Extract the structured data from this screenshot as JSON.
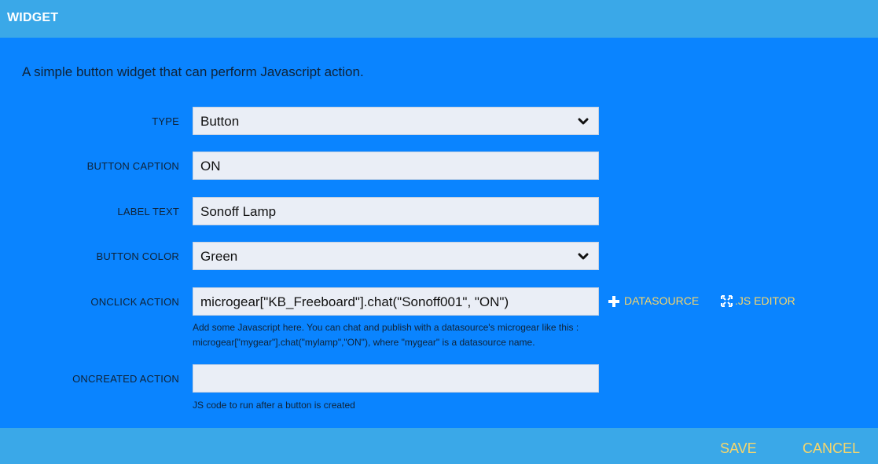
{
  "header": {
    "title": "WIDGET"
  },
  "description": "A simple button widget that can perform Javascript action.",
  "form": {
    "type": {
      "label": "TYPE",
      "value": "Button"
    },
    "button_caption": {
      "label": "BUTTON CAPTION",
      "value": "ON"
    },
    "label_text": {
      "label": "LABEL TEXT",
      "value": "Sonoff Lamp"
    },
    "button_color": {
      "label": "BUTTON COLOR",
      "value": "Green"
    },
    "onclick_action": {
      "label": "ONCLICK ACTION",
      "value": "microgear[\"KB_Freeboard\"].chat(\"Sonoff001\", \"ON\")",
      "hint_line1": "Add some Javascript here. You can chat and publish with a datasource's microgear like this :",
      "hint_line2": "microgear[\"mygear\"].chat(\"mylamp\",\"ON\"), where \"mygear\" is a datasource name.",
      "datasource_link": "DATASOURCE",
      "js_editor_link": ".JS EDITOR"
    },
    "oncreated_action": {
      "label": "ONCREATED ACTION",
      "value": "",
      "hint": "JS code to run after a button is created"
    }
  },
  "footer": {
    "save_label": "SAVE",
    "cancel_label": "CANCEL"
  },
  "colors": {
    "header_bg": "#3aa8e8",
    "body_bg": "#0a84ff",
    "accent_text": "#f6d66b"
  },
  "icons": {
    "plus": "plus-icon",
    "expand": "expand-icon",
    "chevron": "chevron-down-icon"
  }
}
